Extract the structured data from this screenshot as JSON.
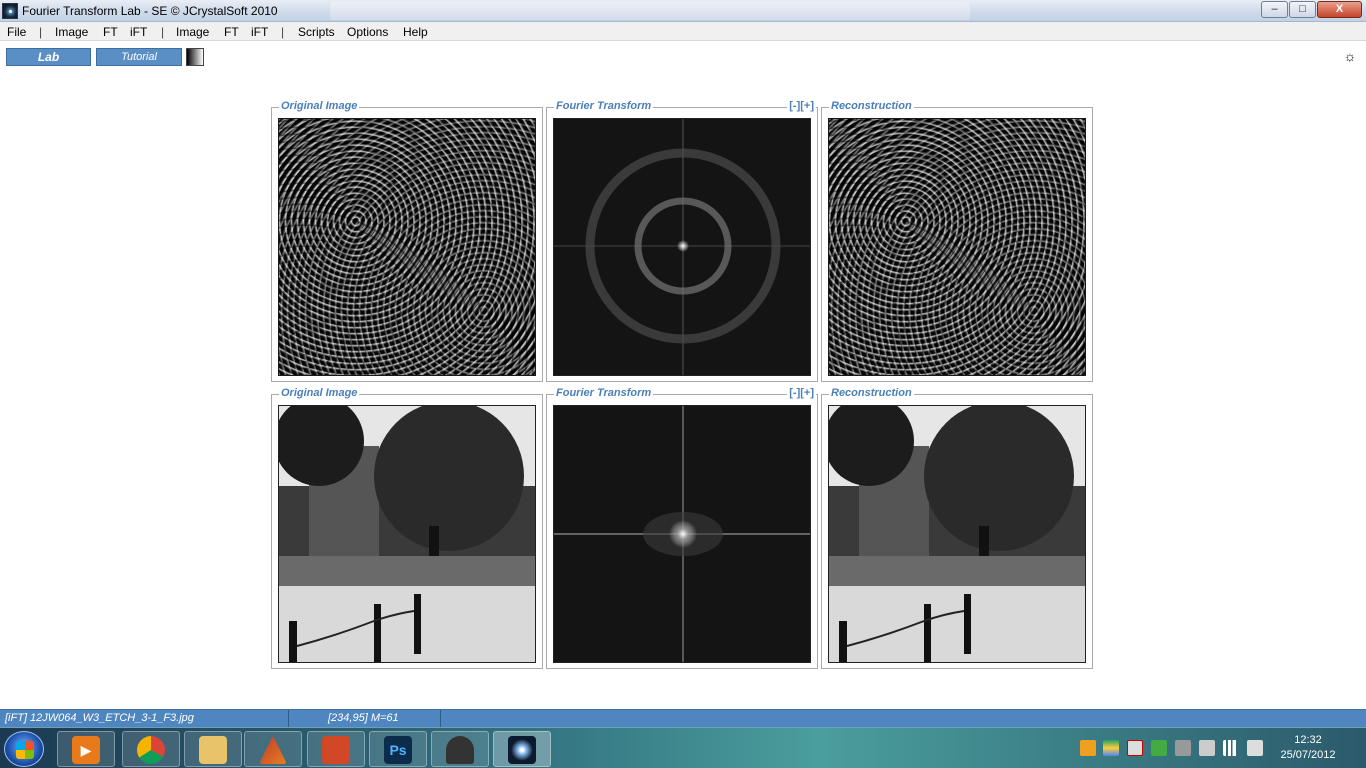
{
  "window": {
    "title": "Fourier Transform Lab - SE  © JCrystalSoft 2010",
    "minimize_label": "–",
    "maximize_label": "□",
    "close_label": "X"
  },
  "menu": {
    "items": [
      "File",
      "Image",
      "FT",
      "iFT",
      "Image",
      "FT",
      "iFT",
      "Scripts",
      "Options",
      "Help"
    ],
    "separator": "|"
  },
  "toolbar": {
    "lab_label": "Lab",
    "tutorial_label": "Tutorial",
    "settings_icon": "gear-icon"
  },
  "panels": {
    "row1": {
      "original_label": "Original Image",
      "ft_label": "Fourier Transform",
      "zoom_label": "[-][+]",
      "recon_label": "Reconstruction"
    },
    "row2": {
      "original_label": "Original Image",
      "ft_label": "Fourier Transform",
      "zoom_label": "[-][+]",
      "recon_label": "Reconstruction"
    }
  },
  "status": {
    "file": "[iFT] 12JW064_W3_ETCH_3-1_F3.jpg",
    "coords": "[234,95]  M=61"
  },
  "taskbar": {
    "apps": [
      "media-player-icon",
      "chrome-icon",
      "explorer-icon",
      "matlab-icon",
      "powerpoint-icon",
      "photoshop-icon",
      "inkscape-icon",
      "fourier-lab-icon"
    ],
    "photoshop_glyph": "Ps",
    "clock_time": "12:32",
    "clock_date": "25/07/2012"
  },
  "colors": {
    "accent": "#5a8fc6",
    "label": "#4a7fb8",
    "status_bar": "#4f86c0"
  }
}
